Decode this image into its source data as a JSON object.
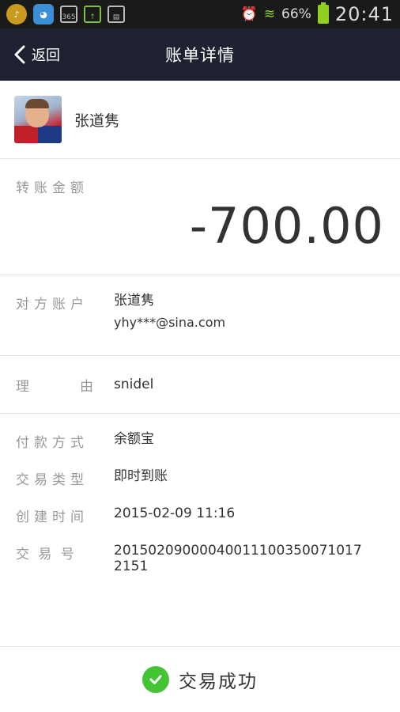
{
  "status_bar": {
    "icons": [
      "music-icon",
      "chat-icon",
      "calendar-icon",
      "upload-icon",
      "sim-icon"
    ],
    "calendar_label": "365",
    "battery_percent": "66%",
    "time": "20:41"
  },
  "header": {
    "back_label": "返回",
    "title": "账单详情"
  },
  "user": {
    "name": "张道隽"
  },
  "amount": {
    "label": "转账金额",
    "value": "-700.00"
  },
  "account": {
    "label": "对方账户",
    "name": "张道隽",
    "email": "yhy***@sina.com"
  },
  "reason": {
    "label_chars": [
      "理",
      "由"
    ],
    "value": "snidel"
  },
  "details": [
    {
      "label": "付款方式",
      "value": "余额宝"
    },
    {
      "label": "交易类型",
      "value": "即时到账"
    },
    {
      "label": "创建时间",
      "value": "2015-02-09 11:16"
    },
    {
      "label": "交 易 号",
      "value": "201502090000400111003500710172151"
    }
  ],
  "result": {
    "text": "交易成功",
    "color": "#44c335"
  }
}
